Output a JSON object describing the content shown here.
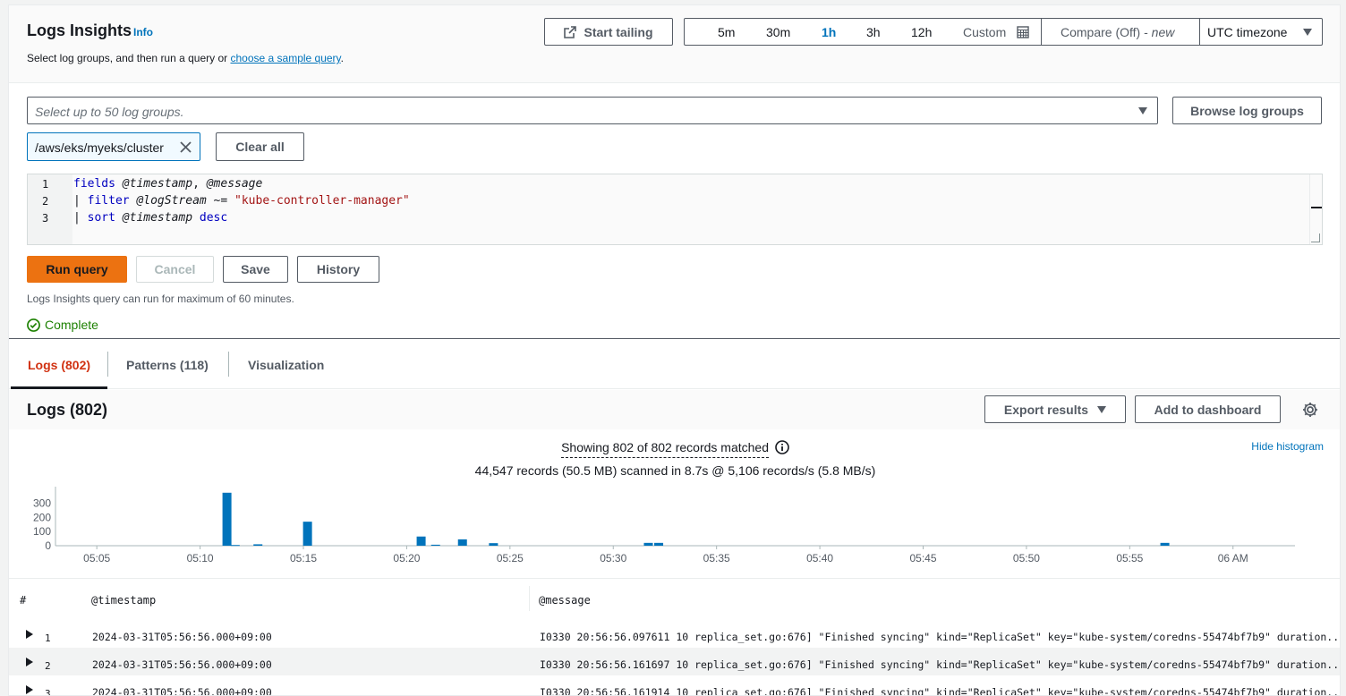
{
  "header": {
    "title": "Logs Insights",
    "info_link": "Info",
    "subtitle_prefix": "Select log groups, and then run a query or ",
    "subtitle_link": "choose a sample query",
    "subtitle_suffix": ".",
    "start_tailing": "Start tailing",
    "time_ranges": [
      "5m",
      "30m",
      "1h",
      "3h",
      "12h"
    ],
    "selected_range": "1h",
    "custom_label": "Custom",
    "compare_label": "Compare (Off) - ",
    "compare_new": "new",
    "timezone": "UTC timezone"
  },
  "query": {
    "log_group_placeholder": "Select up to 50 log groups.",
    "browse_button": "Browse log groups",
    "selected_group": "/aws/eks/myeks/cluster",
    "clear_all": "Clear all",
    "lines": [
      {
        "n": "1",
        "parts": [
          [
            "kw",
            "fields"
          ],
          [
            "at",
            " @timestamp"
          ],
          [
            "plain",
            ", "
          ],
          [
            "at",
            "@message"
          ]
        ]
      },
      {
        "n": "2",
        "parts": [
          [
            "plain",
            "| "
          ],
          [
            "kw",
            "filter"
          ],
          [
            "at",
            " @logStream"
          ],
          [
            "plain",
            " ~= "
          ],
          [
            "str",
            "\"kube-controller-manager\""
          ]
        ]
      },
      {
        "n": "3",
        "parts": [
          [
            "plain",
            "| "
          ],
          [
            "kw",
            "sort"
          ],
          [
            "at",
            " @timestamp"
          ],
          [
            "plain",
            " "
          ],
          [
            "kw",
            "desc"
          ]
        ]
      }
    ],
    "run": "Run query",
    "cancel": "Cancel",
    "save": "Save",
    "history": "History",
    "max_note": "Logs Insights query can run for maximum of 60 minutes.",
    "status": "Complete"
  },
  "tabs": [
    {
      "label": "Logs (802)",
      "active": true
    },
    {
      "label": "Patterns (118)",
      "active": false
    },
    {
      "label": "Visualization",
      "active": false
    }
  ],
  "results": {
    "title": "Logs (802)",
    "export": "Export results",
    "add_dashboard": "Add to dashboard",
    "showing": "Showing 802 of 802 records matched",
    "scanned": "44,547 records (50.5 MB) scanned in 8.7s @ 5,106 records/s (5.8 MB/s)",
    "hide_histogram": "Hide histogram"
  },
  "chart_data": {
    "type": "bar",
    "x_ticks": [
      "05:05",
      "05:10",
      "05:15",
      "05:20",
      "05:25",
      "05:30",
      "05:35",
      "05:40",
      "05:45",
      "05:50",
      "05:55",
      "06 AM"
    ],
    "y_ticks": [
      "300",
      "200",
      "100",
      "0"
    ],
    "ylim": [
      0,
      380
    ],
    "xlim_minutes": [
      3,
      63
    ],
    "bars": [
      {
        "t": 11.3,
        "v": 375
      },
      {
        "t": 11.7,
        "v": 5
      },
      {
        "t": 12.8,
        "v": 10
      },
      {
        "t": 15.2,
        "v": 170
      },
      {
        "t": 20.7,
        "v": 65
      },
      {
        "t": 21.4,
        "v": 7
      },
      {
        "t": 22.7,
        "v": 45
      },
      {
        "t": 24.2,
        "v": 18
      },
      {
        "t": 31.7,
        "v": 20
      },
      {
        "t": 32.2,
        "v": 20
      },
      {
        "t": 56.7,
        "v": 20
      }
    ],
    "color": "#0073bb",
    "grid": false
  },
  "table": {
    "columns": [
      "#",
      "@timestamp",
      "@message"
    ],
    "rows": [
      {
        "n": "1",
        "ts": "2024-03-31T05:56:56.000+09:00",
        "msg": "I0330 20:56:56.097611 10 replica_set.go:676] \"Finished syncing\" kind=\"ReplicaSet\" key=\"kube-system/coredns-55474bf7b9\" duration..."
      },
      {
        "n": "2",
        "ts": "2024-03-31T05:56:56.000+09:00",
        "msg": "I0330 20:56:56.161697 10 replica_set.go:676] \"Finished syncing\" kind=\"ReplicaSet\" key=\"kube-system/coredns-55474bf7b9\" duration..."
      },
      {
        "n": "3",
        "ts": "2024-03-31T05:56:56.000+09:00",
        "msg": "I0330 20:56:56.161914 10 replica_set.go:676] \"Finished syncing\" kind=\"ReplicaSet\" key=\"kube-system/coredns-55474bf7b9\" duration..."
      }
    ]
  }
}
